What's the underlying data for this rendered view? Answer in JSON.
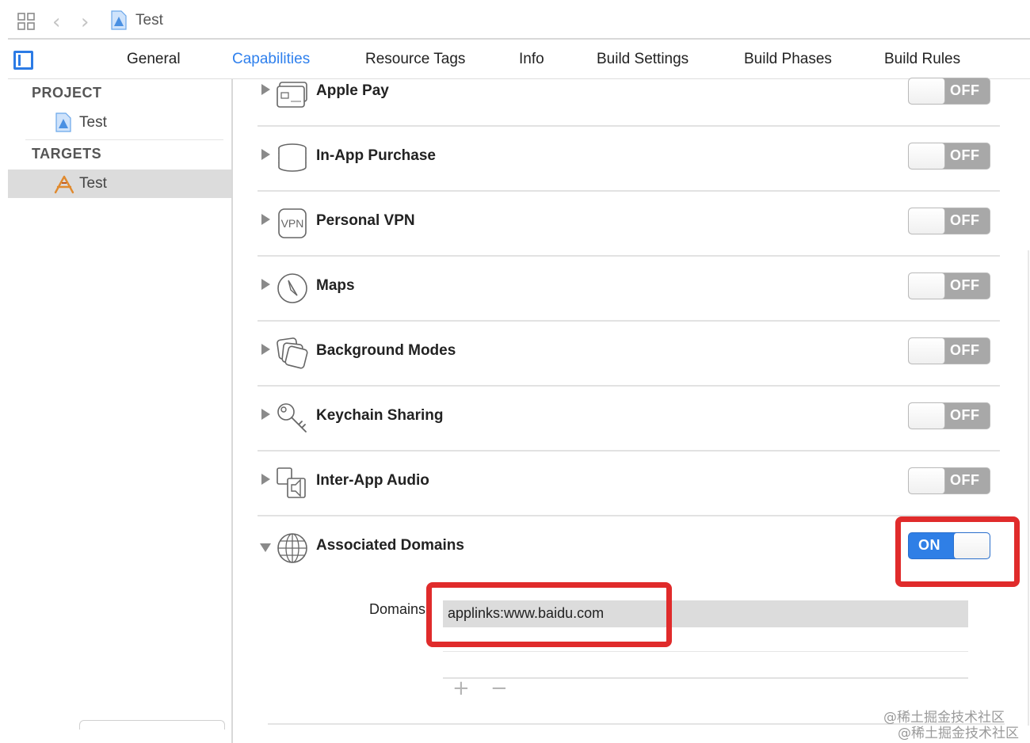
{
  "jumpbar": {
    "file": "Test"
  },
  "tabs": [
    "General",
    "Capabilities",
    "Resource Tags",
    "Info",
    "Build Settings",
    "Build Phases",
    "Build Rules"
  ],
  "active_tab": "Capabilities",
  "sidebar": {
    "project_header": "PROJECT",
    "project_item": "Test",
    "targets_header": "TARGETS",
    "target_item": "Test"
  },
  "capabilities": [
    {
      "name": "Apple Pay",
      "icon": "apple-pay-icon",
      "state": "OFF"
    },
    {
      "name": "In-App Purchase",
      "icon": "coin-stack-icon",
      "state": "OFF"
    },
    {
      "name": "Personal VPN",
      "icon": "vpn-icon",
      "state": "OFF"
    },
    {
      "name": "Maps",
      "icon": "compass-icon",
      "state": "OFF"
    },
    {
      "name": "Background Modes",
      "icon": "stacked-windows-icon",
      "state": "OFF"
    },
    {
      "name": "Keychain Sharing",
      "icon": "key-icon",
      "state": "OFF"
    },
    {
      "name": "Inter-App Audio",
      "icon": "speaker-icon",
      "state": "OFF"
    },
    {
      "name": "Associated Domains",
      "icon": "globe-icon",
      "state": "ON"
    }
  ],
  "associated_domains": {
    "label": "Domains",
    "value": "applinks:www.baidu.com",
    "add": "+",
    "remove": "−"
  },
  "highlight_color": "#e02b2b",
  "accent_color": "#2f80ed",
  "watermark": [
    "@稀土掘金技术社区",
    "@稀土掘金技术社区"
  ]
}
